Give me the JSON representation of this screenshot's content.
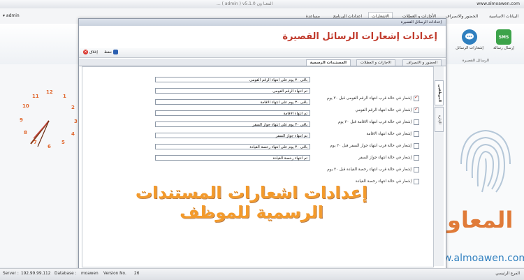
{
  "window": {
    "title": "... ( admin ) v5.1.0 المعـا ون",
    "user": "admin",
    "site_url": "www.almoawen.com"
  },
  "menu": {
    "tabs": [
      {
        "label": "البيانات الاساسية",
        "active": false
      },
      {
        "label": "الحضور والانصراف",
        "active": false
      },
      {
        "label": "الأجازات و العطلات",
        "active": false
      },
      {
        "label": "الاشعارات",
        "active": true
      },
      {
        "label": "اعدادات البرنامج",
        "active": false
      },
      {
        "label": "مساعدة",
        "active": false
      }
    ]
  },
  "ribbon": {
    "buttons": [
      {
        "label": "إرسال رسالة",
        "icon": "sms-icon",
        "badge": "SMS"
      },
      {
        "label": "إشعارات الرسائل",
        "icon": "chat-icon",
        "badge": ""
      }
    ],
    "group_label": "الرسائل القصيرة"
  },
  "clock": {
    "numbers": [
      "12",
      "1",
      "2",
      "3",
      "4",
      "5",
      "6",
      "7",
      "8",
      "9",
      "10",
      "11"
    ]
  },
  "dialog": {
    "window_title": "إعدادات الرسائل القصيرة",
    "heading": "إعدادات إشعارات الرسائل القصيرة",
    "toolbar": {
      "save": "حفظ",
      "close": "إغلاق"
    },
    "tabs": [
      {
        "label": "الحضور و الانصراف",
        "active": false
      },
      {
        "label": "الاجازات و العطلات",
        "active": false
      },
      {
        "label": "المستندات الرسمية",
        "active": true
      }
    ],
    "side_tabs": [
      {
        "label": "الموظفين",
        "active": true
      },
      {
        "label": "الإدارة",
        "active": false
      }
    ],
    "rows": [
      {
        "label": "إشعار في حالة قرب انتهاء الرقم القومى قبل ٣٠ يوم",
        "checked": true,
        "value": "باقى ٣٠ يوم على انتهاء الرقم القومى"
      },
      {
        "label": "إشعار في حالة انتهاء الرقم القومي",
        "checked": true,
        "value": "تم انتهاء الرقم القومى"
      },
      {
        "label": "إشعار في حالة قرب انتهاء الاقامة قبل ٣٠ يوم",
        "checked": false,
        "value": "باقى ٣٠ يوم على انتهاء الاقامة"
      },
      {
        "label": "إشعار في حالة انتهاء الاقامة",
        "checked": false,
        "value": "تم انتهاء الاقامة"
      },
      {
        "label": "إشعار في حالة قرب انتهاء جواز السفر قبل ٣٠ يوم",
        "checked": false,
        "value": "باقى ٣٠ يوم على انتهاء جواز السفر"
      },
      {
        "label": "إشعار في حالة انتهاء جواز السفر",
        "checked": false,
        "value": "تم انتهاء جواز السفر"
      },
      {
        "label": "إشعار في حالة قرب انتهاء رخصة القيادة قبل ٣٠ يوم",
        "checked": false,
        "value": "باقى ٣٠ يوم على انتهاء رخصة القيادة"
      },
      {
        "label": "إشعار في حالة انتهاء رخصة القيادة",
        "checked": false,
        "value": "تم انتهاء رخصة القيادة"
      }
    ]
  },
  "overlay_caption": "إعدادات اشعارات المستندات الرسمية للموظف",
  "branding": {
    "logo": "المعاو",
    "site": "www.almoawen.com"
  },
  "status": {
    "server_label": "Server :",
    "server": "192.99.99.112",
    "db_label": "Database :",
    "db": "moawen",
    "version_label": "Version No.",
    "version": "26",
    "branch": "الفرع الرئيسي"
  },
  "colors": {
    "accent": "#c0392b",
    "caption": "#f39a2b",
    "clock": "#e0662d",
    "brand_blue": "#2f7fbf"
  }
}
